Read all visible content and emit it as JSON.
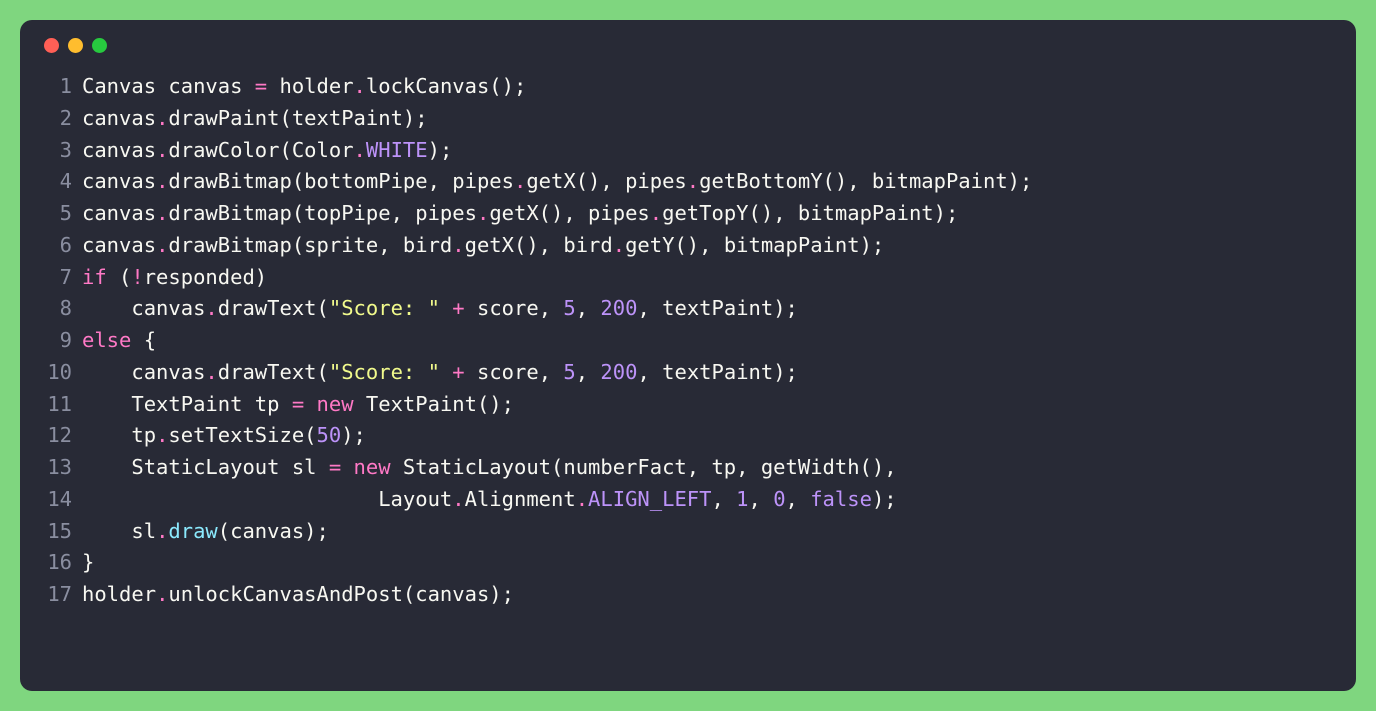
{
  "colors": {
    "background": "#7fd67f",
    "editor_bg": "#282a36",
    "red_dot": "#ff5f56",
    "yellow_dot": "#ffbd2e",
    "green_dot": "#27c93f",
    "default": "#f8f8f2",
    "pink": "#ff79c6",
    "purple": "#bd93f9",
    "yellow": "#f1fa8c",
    "cyan": "#8be9fd",
    "lineno": "#8a8ea0"
  },
  "lines": [
    {
      "n": "1",
      "tokens": [
        {
          "t": "Canvas canvas ",
          "c": "default"
        },
        {
          "t": "=",
          "c": "pink"
        },
        {
          "t": " holder",
          "c": "default"
        },
        {
          "t": ".",
          "c": "pink"
        },
        {
          "t": "lockCanvas();",
          "c": "default"
        }
      ]
    },
    {
      "n": "2",
      "tokens": [
        {
          "t": "canvas",
          "c": "default"
        },
        {
          "t": ".",
          "c": "pink"
        },
        {
          "t": "drawPaint(textPaint);",
          "c": "default"
        }
      ]
    },
    {
      "n": "3",
      "tokens": [
        {
          "t": "canvas",
          "c": "default"
        },
        {
          "t": ".",
          "c": "pink"
        },
        {
          "t": "drawColor(Color",
          "c": "default"
        },
        {
          "t": ".",
          "c": "pink"
        },
        {
          "t": "WHITE",
          "c": "purple"
        },
        {
          "t": ");",
          "c": "default"
        }
      ]
    },
    {
      "n": "4",
      "tokens": [
        {
          "t": "canvas",
          "c": "default"
        },
        {
          "t": ".",
          "c": "pink"
        },
        {
          "t": "drawBitmap(bottomPipe, pipes",
          "c": "default"
        },
        {
          "t": ".",
          "c": "pink"
        },
        {
          "t": "getX(), pipes",
          "c": "default"
        },
        {
          "t": ".",
          "c": "pink"
        },
        {
          "t": "getBottomY(), bitmapPaint);",
          "c": "default"
        }
      ]
    },
    {
      "n": "5",
      "tokens": [
        {
          "t": "canvas",
          "c": "default"
        },
        {
          "t": ".",
          "c": "pink"
        },
        {
          "t": "drawBitmap(topPipe, pipes",
          "c": "default"
        },
        {
          "t": ".",
          "c": "pink"
        },
        {
          "t": "getX(), pipes",
          "c": "default"
        },
        {
          "t": ".",
          "c": "pink"
        },
        {
          "t": "getTopY(), bitmapPaint);",
          "c": "default"
        }
      ]
    },
    {
      "n": "6",
      "tokens": [
        {
          "t": "canvas",
          "c": "default"
        },
        {
          "t": ".",
          "c": "pink"
        },
        {
          "t": "drawBitmap(sprite, bird",
          "c": "default"
        },
        {
          "t": ".",
          "c": "pink"
        },
        {
          "t": "getX(), bird",
          "c": "default"
        },
        {
          "t": ".",
          "c": "pink"
        },
        {
          "t": "getY(), bitmapPaint);",
          "c": "default"
        }
      ]
    },
    {
      "n": "7",
      "tokens": [
        {
          "t": "if",
          "c": "pink"
        },
        {
          "t": " (",
          "c": "default"
        },
        {
          "t": "!",
          "c": "pink"
        },
        {
          "t": "responded)",
          "c": "default"
        }
      ]
    },
    {
      "n": "8",
      "tokens": [
        {
          "t": "    canvas",
          "c": "default"
        },
        {
          "t": ".",
          "c": "pink"
        },
        {
          "t": "drawText(",
          "c": "default"
        },
        {
          "t": "\"Score: \"",
          "c": "yellow"
        },
        {
          "t": " ",
          "c": "default"
        },
        {
          "t": "+",
          "c": "pink"
        },
        {
          "t": " score, ",
          "c": "default"
        },
        {
          "t": "5",
          "c": "purple"
        },
        {
          "t": ", ",
          "c": "default"
        },
        {
          "t": "200",
          "c": "purple"
        },
        {
          "t": ", textPaint);",
          "c": "default"
        }
      ]
    },
    {
      "n": "9",
      "tokens": [
        {
          "t": "else",
          "c": "pink"
        },
        {
          "t": " {",
          "c": "default"
        }
      ]
    },
    {
      "n": "10",
      "tokens": [
        {
          "t": "    canvas",
          "c": "default"
        },
        {
          "t": ".",
          "c": "pink"
        },
        {
          "t": "drawText(",
          "c": "default"
        },
        {
          "t": "\"Score: \"",
          "c": "yellow"
        },
        {
          "t": " ",
          "c": "default"
        },
        {
          "t": "+",
          "c": "pink"
        },
        {
          "t": " score, ",
          "c": "default"
        },
        {
          "t": "5",
          "c": "purple"
        },
        {
          "t": ", ",
          "c": "default"
        },
        {
          "t": "200",
          "c": "purple"
        },
        {
          "t": ", textPaint);",
          "c": "default"
        }
      ]
    },
    {
      "n": "11",
      "tokens": [
        {
          "t": "    TextPaint tp ",
          "c": "default"
        },
        {
          "t": "=",
          "c": "pink"
        },
        {
          "t": " ",
          "c": "default"
        },
        {
          "t": "new",
          "c": "pink"
        },
        {
          "t": " TextPaint();",
          "c": "default"
        }
      ]
    },
    {
      "n": "12",
      "tokens": [
        {
          "t": "    tp",
          "c": "default"
        },
        {
          "t": ".",
          "c": "pink"
        },
        {
          "t": "setTextSize(",
          "c": "default"
        },
        {
          "t": "50",
          "c": "purple"
        },
        {
          "t": ");",
          "c": "default"
        }
      ]
    },
    {
      "n": "13",
      "tokens": [
        {
          "t": "    StaticLayout sl ",
          "c": "default"
        },
        {
          "t": "=",
          "c": "pink"
        },
        {
          "t": " ",
          "c": "default"
        },
        {
          "t": "new",
          "c": "pink"
        },
        {
          "t": " StaticLayout(numberFact, tp, getWidth(),",
          "c": "default"
        }
      ]
    },
    {
      "n": "14",
      "tokens": [
        {
          "t": "                        Layout",
          "c": "default"
        },
        {
          "t": ".",
          "c": "pink"
        },
        {
          "t": "Alignment",
          "c": "default"
        },
        {
          "t": ".",
          "c": "pink"
        },
        {
          "t": "ALIGN_LEFT",
          "c": "purple"
        },
        {
          "t": ", ",
          "c": "default"
        },
        {
          "t": "1",
          "c": "purple"
        },
        {
          "t": ", ",
          "c": "default"
        },
        {
          "t": "0",
          "c": "purple"
        },
        {
          "t": ", ",
          "c": "default"
        },
        {
          "t": "false",
          "c": "purple"
        },
        {
          "t": ");",
          "c": "default"
        }
      ]
    },
    {
      "n": "15",
      "tokens": [
        {
          "t": "    sl",
          "c": "default"
        },
        {
          "t": ".",
          "c": "pink"
        },
        {
          "t": "draw",
          "c": "cyan"
        },
        {
          "t": "(canvas);",
          "c": "default"
        }
      ]
    },
    {
      "n": "16",
      "tokens": [
        {
          "t": "}",
          "c": "default"
        }
      ]
    },
    {
      "n": "17",
      "tokens": [
        {
          "t": "holder",
          "c": "default"
        },
        {
          "t": ".",
          "c": "pink"
        },
        {
          "t": "unlockCanvasAndPost(canvas);",
          "c": "default"
        }
      ]
    }
  ]
}
